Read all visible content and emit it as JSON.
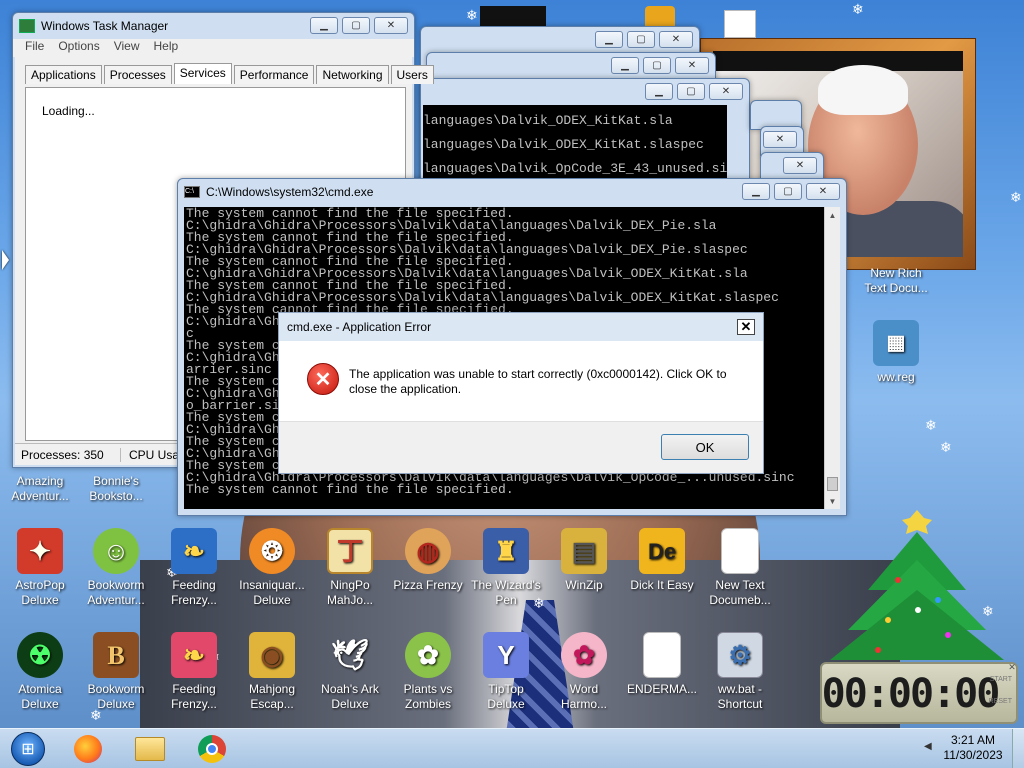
{
  "taskmgr": {
    "title": "Windows Task Manager",
    "menu": [
      "File",
      "Options",
      "View",
      "Help"
    ],
    "tabs": [
      "Applications",
      "Processes",
      "Services",
      "Performance",
      "Networking",
      "Users"
    ],
    "active_tab": "Services",
    "loading": "Loading...",
    "processes": "Processes: 350",
    "cpu": "CPU Usag"
  },
  "cmd": {
    "title": "C:\\Windows\\system32\\cmd.exe",
    "lines": [
      "The system cannot find the file specified.",
      "C:\\ghidra\\Ghidra\\Processors\\Dalvik\\data\\languages\\Dalvik_DEX_Pie.sla",
      "The system cannot find the file specified.",
      "C:\\ghidra\\Ghidra\\Processors\\Dalvik\\data\\languages\\Dalvik_DEX_Pie.slaspec",
      "The system cannot find the file specified.",
      "C:\\ghidra\\Ghidra\\Processors\\Dalvik\\data\\languages\\Dalvik_ODEX_KitKat.sla",
      "The system cannot find the file specified.",
      "C:\\ghidra\\Ghidra\\Processors\\Dalvik\\data\\languages\\Dalvik_ODEX_KitKat.slaspec",
      "The system cannot find the file specified.",
      "C:\\ghidra\\Gh                                                    used.sinc",
      "c",
      "The system c",
      "C:\\ghidra\\Gh                                                    n_void_b",
      "arrier.sinc",
      "The system c",
      "C:\\ghidra\\Gh                                                    n_void_n",
      "o_barrier.si",
      "The system c",
      "C:\\ghidra\\Gh                                                    l.sinc",
      "The system c",
      "C:\\ghidra\\Gh                                                    l.sinc",
      "The system c",
      "C:\\ghidra\\Ghidra\\Processors\\Dalvik\\data\\languages\\Dalvik_OpCode_...unused.sinc",
      "The system cannot find the file specified."
    ],
    "bg_lines": [
      "languages\\Dalvik_ODEX_KitKat.sla",
      "languages\\Dalvik_ODEX_KitKat.slaspec",
      "languages\\Dalvik_OpCode_3E_43_unused.sinc"
    ]
  },
  "error": {
    "title": "cmd.exe - Application Error",
    "message": "The application was unable to start correctly (0xc0000142). Click OK to close the application.",
    "ok": "OK"
  },
  "desktop_icons_top": [
    {
      "label": "New Rich Text Docu..."
    },
    {
      "label": "ww.reg"
    }
  ],
  "desktop_row1": [
    {
      "label": "Amazing Adventur...",
      "icon": "amazing-adventures-icon"
    },
    {
      "label": "Bonnie's Booksto...",
      "icon": "bonnies-bookstore-icon"
    }
  ],
  "desktop_row2": [
    {
      "label": "AstroPop Deluxe",
      "icon": "astropop-icon",
      "color": "#d23a2a",
      "glyph": "✦"
    },
    {
      "label": "Bookworm Adventur...",
      "icon": "bookworm-icon",
      "color": "#7fc241",
      "glyph": "☺"
    },
    {
      "label": "Feeding Frenzy...",
      "icon": "feeding-frenzy-icon",
      "color": "#2d6fc7",
      "glyph": "❧"
    },
    {
      "label": "Insaniquar... Deluxe",
      "icon": "insaniquarium-icon",
      "color": "#f08a24",
      "glyph": "❂"
    },
    {
      "label": "NingPo MahJo...",
      "icon": "ningpo-icon",
      "color": "#e5c25a",
      "glyph": "丁"
    },
    {
      "label": "Pizza Frenzy",
      "icon": "pizza-icon",
      "color": "#e0a35a",
      "glyph": "◍"
    },
    {
      "label": "The Wizard's Pen",
      "icon": "wizard-pen-icon",
      "color": "#3b5ea9",
      "glyph": "♜"
    },
    {
      "label": "WinZip",
      "icon": "winzip-icon",
      "color": "#d8b23c",
      "glyph": "▤"
    },
    {
      "label": "Dick It Easy",
      "icon": "dick-it-easy-icon",
      "color": "#f0b51c",
      "glyph": "De"
    },
    {
      "label": "New Text Documeb...",
      "icon": "text-document-icon",
      "color": "#ffffff",
      "glyph": "▯"
    }
  ],
  "desktop_row3": [
    {
      "label": "Atomica Deluxe",
      "icon": "atomica-icon",
      "color": "#1c7a2c",
      "glyph": "☢"
    },
    {
      "label": "Bookworm Deluxe",
      "icon": "bookworm-deluxe-icon",
      "color": "#8a4e22",
      "glyph": "B"
    },
    {
      "label": "Feeding Frenzy...",
      "icon": "feeding-frenzy-2-icon",
      "color": "#e2486a",
      "glyph": "❧"
    },
    {
      "label": "Mahjong Escap...",
      "icon": "mahjong-escape-icon",
      "color": "#e0b33a",
      "glyph": "◉"
    },
    {
      "label": "Noah's Ark Deluxe",
      "icon": "noahs-ark-icon",
      "color": "#ffffff",
      "glyph": "🕊"
    },
    {
      "label": "Plants vs Zombies",
      "icon": "pvz-icon",
      "color": "#8bc34a",
      "glyph": "✿"
    },
    {
      "label": "TipTop Deluxe",
      "icon": "tiptop-icon",
      "color": "#6a7fe0",
      "glyph": "Y"
    },
    {
      "label": "Word Harmo...",
      "icon": "word-harmony-icon",
      "color": "#e77fa0",
      "glyph": "✿"
    },
    {
      "label": "ENDERMA...",
      "icon": "enderman-file-icon",
      "color": "#ffffff",
      "glyph": "▯"
    },
    {
      "label": "ww.bat - Shortcut",
      "icon": "batch-shortcut-icon",
      "color": "#cfd8e3",
      "glyph": "⚙"
    }
  ],
  "clock_gadget": {
    "time": "00:00:00",
    "start": "START",
    "reset": "RESET"
  },
  "taskbar": {
    "time": "3:21 AM",
    "date": "11/30/2023",
    "apps": [
      "start-orb-icon",
      "firefox-icon",
      "explorer-icon",
      "chrome-icon"
    ]
  }
}
